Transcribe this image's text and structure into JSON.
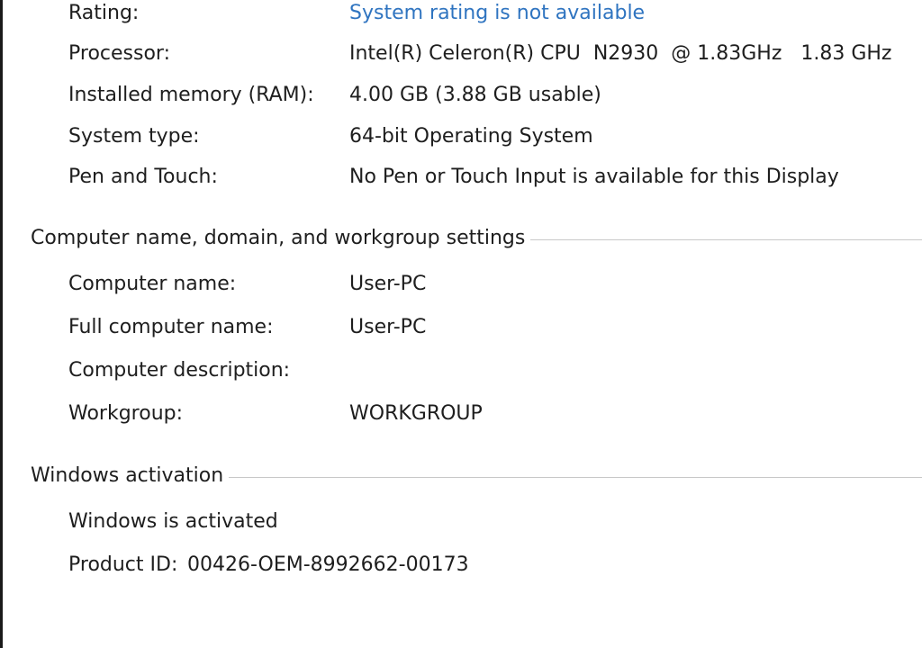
{
  "system": {
    "rating": {
      "label": "Rating:",
      "value": "System rating is not available"
    },
    "processor": {
      "label": "Processor:",
      "value": "Intel(R) Celeron(R) CPU  N2930  @ 1.83GHz   1.83 GHz"
    },
    "memory": {
      "label": "Installed memory (RAM):",
      "value": "4.00 GB (3.88 GB usable)"
    },
    "system_type": {
      "label": "System type:",
      "value": "64-bit Operating System"
    },
    "pen_touch": {
      "label": "Pen and Touch:",
      "value": "No Pen or Touch Input is available for this Display"
    }
  },
  "computer_name_section": {
    "title": "Computer name, domain, and workgroup settings",
    "computer_name": {
      "label": "Computer name:",
      "value": "User-PC"
    },
    "full_computer_name": {
      "label": "Full computer name:",
      "value": "User-PC"
    },
    "computer_description": {
      "label": "Computer description:",
      "value": ""
    },
    "workgroup": {
      "label": "Workgroup:",
      "value": "WORKGROUP"
    }
  },
  "activation_section": {
    "title": "Windows activation",
    "status": "Windows is activated",
    "product_id": {
      "label": "Product ID:",
      "value": "00426-OEM-8992662-00173"
    }
  }
}
